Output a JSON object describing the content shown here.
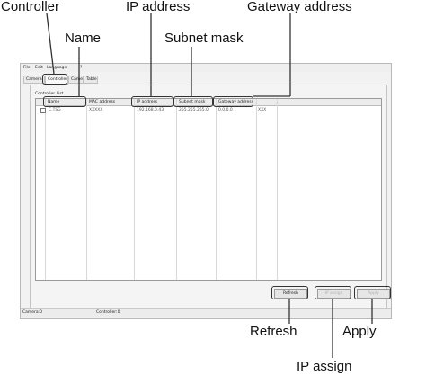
{
  "callouts": {
    "controller": "Controller",
    "ip_address": "IP address",
    "gateway_address": "Gateway address",
    "name": "Name",
    "subnet_mask": "Subnet mask",
    "refresh": "Refresh",
    "apply": "Apply",
    "ip_assign": "IP assign"
  },
  "menubar": [
    "File",
    "Edit",
    "Language",
    "?"
  ],
  "tabs": [
    {
      "label": "Camera",
      "active": false
    },
    {
      "label": "Controller",
      "active": true
    },
    {
      "label": "Came",
      "active": false
    },
    {
      "label": "Table",
      "active": false
    }
  ],
  "panel_title": "Controller List",
  "table": {
    "columns": [
      "",
      "Name",
      "MAC address",
      "IP address",
      "Subnet mask",
      "Gateway address",
      ""
    ],
    "rows": [
      {
        "checked": false,
        "cells": [
          "C.TSG",
          "XXXXX",
          "192.168.0.43",
          "255.255.255.0",
          "0.0.0.0",
          "XXX"
        ]
      }
    ]
  },
  "buttons": {
    "refresh": "Refresh",
    "ip_assign": "IP assign",
    "apply": "Apply"
  },
  "status": {
    "camera": "Camera:0",
    "controller": "Controller:0"
  },
  "colors": {
    "window_bg": "#f2f2f2",
    "highlight": "#333333"
  }
}
